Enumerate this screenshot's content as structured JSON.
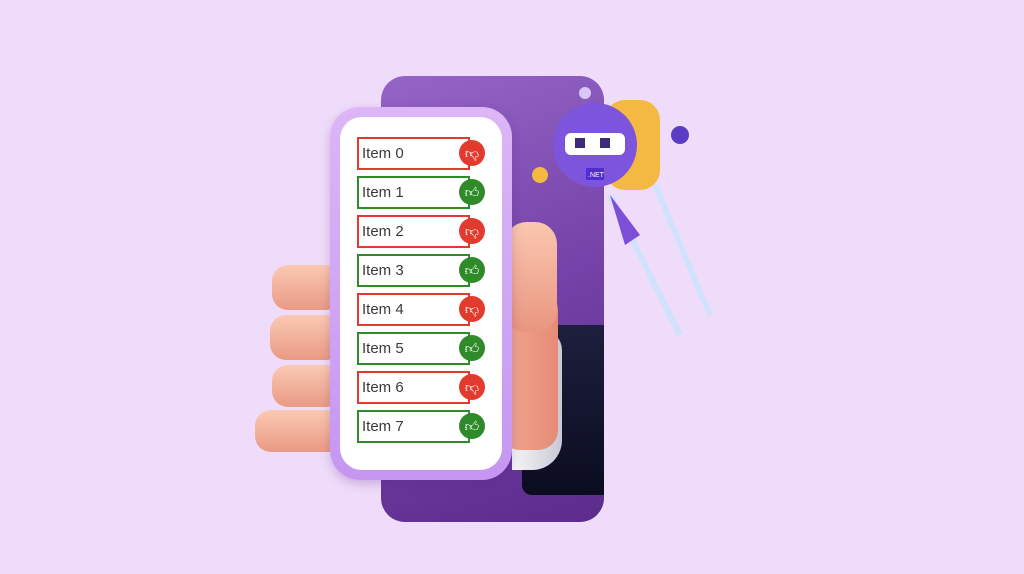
{
  "colors": {
    "background": "#efdcfa",
    "negative": "#e23b2e",
    "positive": "#2f8a2a",
    "panel": "#7442a8"
  },
  "list": {
    "items": [
      {
        "label": "Item 0",
        "status": "dislike",
        "icon": "thumbs-down-icon"
      },
      {
        "label": "Item 1",
        "status": "like",
        "icon": "thumbs-up-icon"
      },
      {
        "label": "Item 2",
        "status": "dislike",
        "icon": "thumbs-down-icon"
      },
      {
        "label": "Item 3",
        "status": "like",
        "icon": "thumbs-up-icon"
      },
      {
        "label": "Item 4",
        "status": "dislike",
        "icon": "thumbs-down-icon"
      },
      {
        "label": "Item 5",
        "status": "like",
        "icon": "thumbs-up-icon"
      },
      {
        "label": "Item 6",
        "status": "dislike",
        "icon": "thumbs-down-icon"
      },
      {
        "label": "Item 7",
        "status": "like",
        "icon": "thumbs-up-icon"
      }
    ]
  },
  "mascot": {
    "badge_text": ".NET"
  }
}
